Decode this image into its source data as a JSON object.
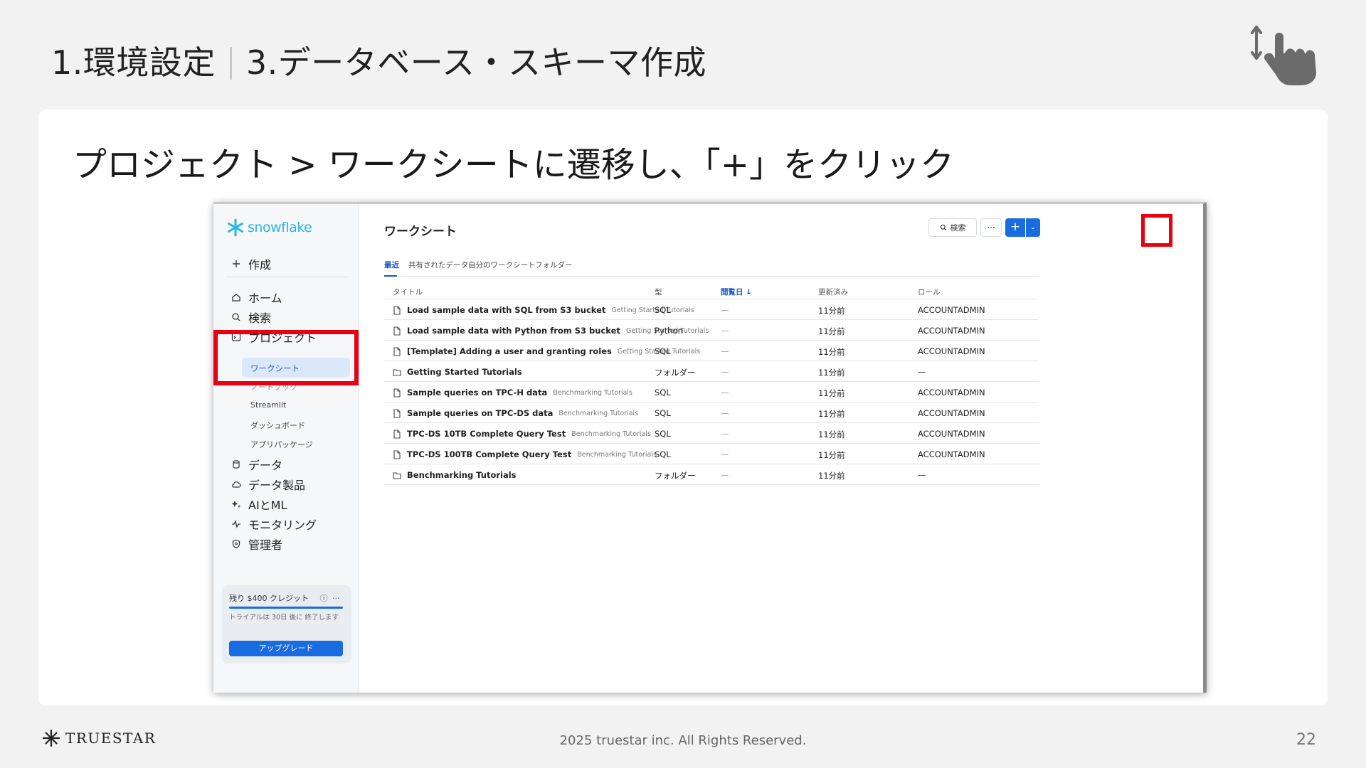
{
  "slide": {
    "title_left": "1.環境設定",
    "title_right": "3.データベース・スキーマ作成",
    "instruction": "プロジェクト > ワークシートに遷移し、「+」をクリック",
    "copyright": "2025 truestar inc. All Rights Reserved.",
    "page_number": "22",
    "brand": "TRUESTAR"
  },
  "app": {
    "logo_text": "snowflake",
    "sidebar": {
      "create": "作成",
      "home": "ホーム",
      "search": "検索",
      "projects": "プロジェクト",
      "worksheets": "ワークシート",
      "notebooks": "ノートブック",
      "streamlit": "Streamlit",
      "dashboards": "ダッシュボード",
      "app_packages": "アプリパッケージ",
      "data": "データ",
      "data_products": "データ製品",
      "ai_ml": "AIとML",
      "monitoring": "モニタリング",
      "admin": "管理者",
      "credit_title": "残り $400 クレジット",
      "credit_note": "トライアルは 30日 後に 終了します",
      "upgrade": "アップグレード"
    },
    "main": {
      "heading": "ワークシート",
      "search_button": "検索",
      "more_button": "···",
      "plus_button": "+",
      "tabs": [
        "最近",
        "共有されたデータ",
        "自分のワークシート",
        "フォルダー"
      ],
      "columns": [
        "タイトル",
        "型",
        "閲覧日",
        "更新済み",
        "ロール"
      ],
      "rows": [
        {
          "title": "Load sample data with SQL from S3 bucket",
          "folder": "Getting Started Tutorials",
          "type": "SQL",
          "viewed": "—",
          "updated": "11分前",
          "role": "ACCOUNTADMIN",
          "kind": "file"
        },
        {
          "title": "Load sample data with Python from S3 bucket",
          "folder": "Getting Started Tutorials",
          "type": "Python",
          "viewed": "—",
          "updated": "11分前",
          "role": "ACCOUNTADMIN",
          "kind": "file"
        },
        {
          "title": "[Template] Adding a user and granting roles",
          "folder": "Getting Started Tutorials",
          "type": "SQL",
          "viewed": "—",
          "updated": "11分前",
          "role": "ACCOUNTADMIN",
          "kind": "file"
        },
        {
          "title": "Getting Started Tutorials",
          "folder": "",
          "type": "フォルダー",
          "viewed": "—",
          "updated": "11分前",
          "role": "—",
          "kind": "folder"
        },
        {
          "title": "Sample queries on TPC-H data",
          "folder": "Benchmarking Tutorials",
          "type": "SQL",
          "viewed": "—",
          "updated": "11分前",
          "role": "ACCOUNTADMIN",
          "kind": "file"
        },
        {
          "title": "Sample queries on TPC-DS data",
          "folder": "Benchmarking Tutorials",
          "type": "SQL",
          "viewed": "—",
          "updated": "11分前",
          "role": "ACCOUNTADMIN",
          "kind": "file"
        },
        {
          "title": "TPC-DS 10TB Complete Query Test",
          "folder": "Benchmarking Tutorials",
          "type": "SQL",
          "viewed": "—",
          "updated": "11分前",
          "role": "ACCOUNTADMIN",
          "kind": "file"
        },
        {
          "title": "TPC-DS 100TB Complete Query Test",
          "folder": "Benchmarking Tutorials",
          "type": "SQL",
          "viewed": "—",
          "updated": "11分前",
          "role": "ACCOUNTADMIN",
          "kind": "file"
        },
        {
          "title": "Benchmarking Tutorials",
          "folder": "",
          "type": "フォルダー",
          "viewed": "—",
          "updated": "11分前",
          "role": "—",
          "kind": "folder"
        }
      ]
    }
  },
  "colors": {
    "highlight": "#e60012",
    "snowflake_blue": "#29b5e8",
    "primary_button": "#1a6ae0"
  }
}
